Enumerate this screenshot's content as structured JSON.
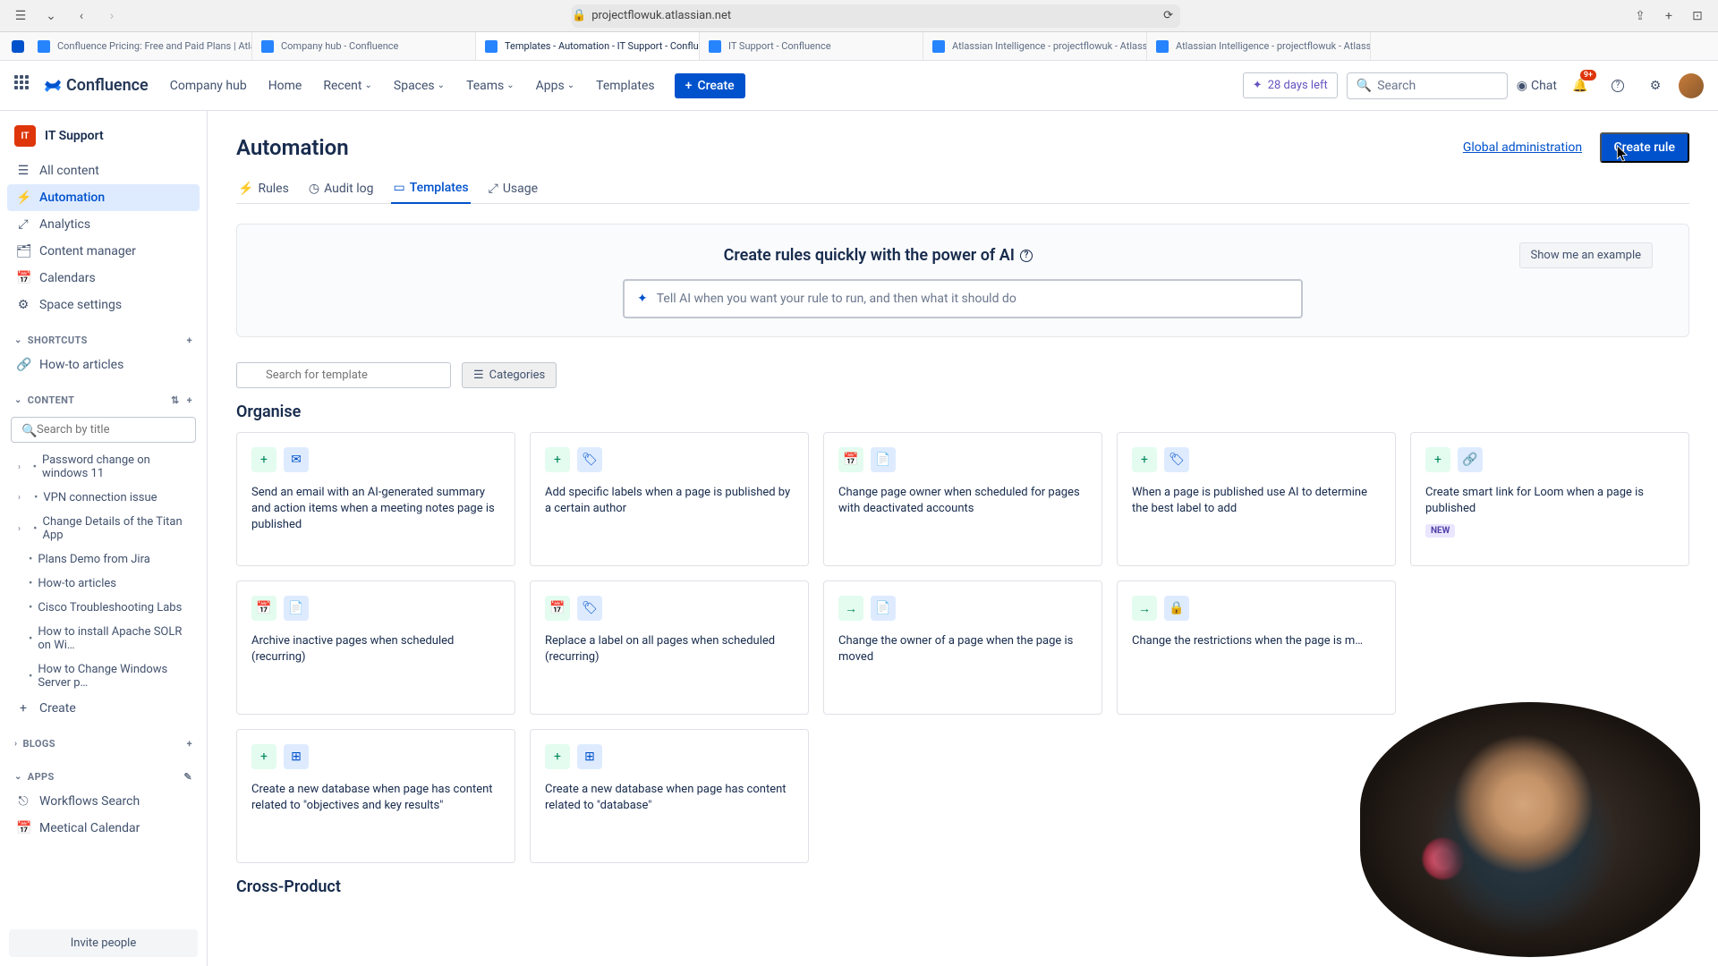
{
  "browser": {
    "url": "projectflowuk.atlassian.net",
    "tabs": [
      {
        "label": "Confluence Pricing: Free and Paid Plans | Atlassian",
        "icon": "#2684ff"
      },
      {
        "label": "Company hub - Confluence",
        "icon": "#2684ff"
      },
      {
        "label": "Templates - Automation - IT Support - Confluence",
        "icon": "#2684ff",
        "active": true
      },
      {
        "label": "IT Support - Confluence",
        "icon": "#2684ff"
      },
      {
        "label": "Atlassian Intelligence - projectflowuk - Atlassian Adm…",
        "icon": "#2684ff"
      },
      {
        "label": "Atlassian Intelligence - projectflowuk - Atlassian Adm…",
        "icon": "#2684ff"
      }
    ]
  },
  "nav": {
    "logo": "Confluence",
    "items": [
      "Company hub",
      "Home",
      "Recent",
      "Spaces",
      "Teams",
      "Apps",
      "Templates"
    ],
    "create": "Create",
    "trial": "28 days left",
    "search_placeholder": "Search",
    "chat": "Chat",
    "notif": "9+"
  },
  "sidebar": {
    "space": "IT Support",
    "primary": [
      {
        "icon": "☰",
        "label": "All content"
      },
      {
        "icon": "⚡",
        "label": "Automation",
        "active": true
      },
      {
        "icon": "⤢",
        "label": "Analytics"
      },
      {
        "icon": "🗂",
        "label": "Content manager"
      },
      {
        "icon": "📅",
        "label": "Calendars"
      },
      {
        "icon": "⚙",
        "label": "Space settings"
      }
    ],
    "shortcuts_label": "SHORTCUTS",
    "shortcuts": [
      {
        "label": "How-to articles"
      }
    ],
    "content_label": "CONTENT",
    "search_placeholder": "Search by title",
    "tree": [
      "Password change on windows 11",
      "VPN connection issue",
      "Change Details of the Titan App",
      "Plans Demo from Jira",
      "How-to articles",
      "Cisco Troubleshooting Labs",
      "How to install Apache SOLR on Wi…",
      "How to Change Windows Server p…"
    ],
    "create_item": "Create",
    "blogs": "BLOGS",
    "apps": "APPS",
    "app_items": [
      "Workflows Search",
      "Meetical Calendar"
    ],
    "invite": "Invite people"
  },
  "page": {
    "title": "Automation",
    "global_admin": "Global administration",
    "create_rule": "Create rule",
    "tabs": [
      {
        "icon": "⚡",
        "label": "Rules"
      },
      {
        "icon": "◷",
        "label": "Audit log"
      },
      {
        "icon": "▭",
        "label": "Templates",
        "active": true
      },
      {
        "icon": "⤢",
        "label": "Usage"
      }
    ],
    "ai": {
      "title": "Create rules quickly with the power of AI",
      "example": "Show me an example",
      "placeholder": "Tell AI when you want your rule to run, and then what it should do"
    },
    "template_search": "Search for template",
    "categories": "Categories",
    "section1": "Organise",
    "cards1": [
      {
        "icons": [
          "plus-green",
          "mail-blue"
        ],
        "desc": "Send an email with an AI-generated summary and action items when a meeting notes page is published"
      },
      {
        "icons": [
          "plus-green",
          "tag-blue"
        ],
        "desc": "Add specific labels when a page is published by a certain author"
      },
      {
        "icons": [
          "cal-green",
          "page-blue"
        ],
        "desc": "Change page owner when scheduled for pages with deactivated accounts"
      },
      {
        "icons": [
          "plus-green",
          "tag-blue"
        ],
        "desc": "When a page is published use AI to determine the best label to add"
      },
      {
        "icons": [
          "plus-green",
          "link-blue"
        ],
        "desc": "Create smart link for Loom when a page is published",
        "new": "NEW"
      },
      {
        "icons": [
          "cal-green",
          "page-blue"
        ],
        "desc": "Archive inactive pages when scheduled (recurring)"
      },
      {
        "icons": [
          "cal-green",
          "tag-blue"
        ],
        "desc": "Replace a label on all pages when scheduled (recurring)"
      },
      {
        "icons": [
          "arrow-green",
          "page-blue"
        ],
        "desc": "Change the owner of a page when the page is moved"
      },
      {
        "icons": [
          "arrow-green",
          "lock-blue"
        ],
        "desc": "Change the restrictions when the page is m…"
      },
      {
        "icons": [
          "plus-green",
          "db-blue"
        ],
        "desc": "Create a new database when page has content related to \"objectives and key results\""
      },
      {
        "icons": [
          "plus-green",
          "db-blue"
        ],
        "desc": "Create a new database when page has content related to \"database\""
      }
    ],
    "section2": "Cross-Product"
  }
}
